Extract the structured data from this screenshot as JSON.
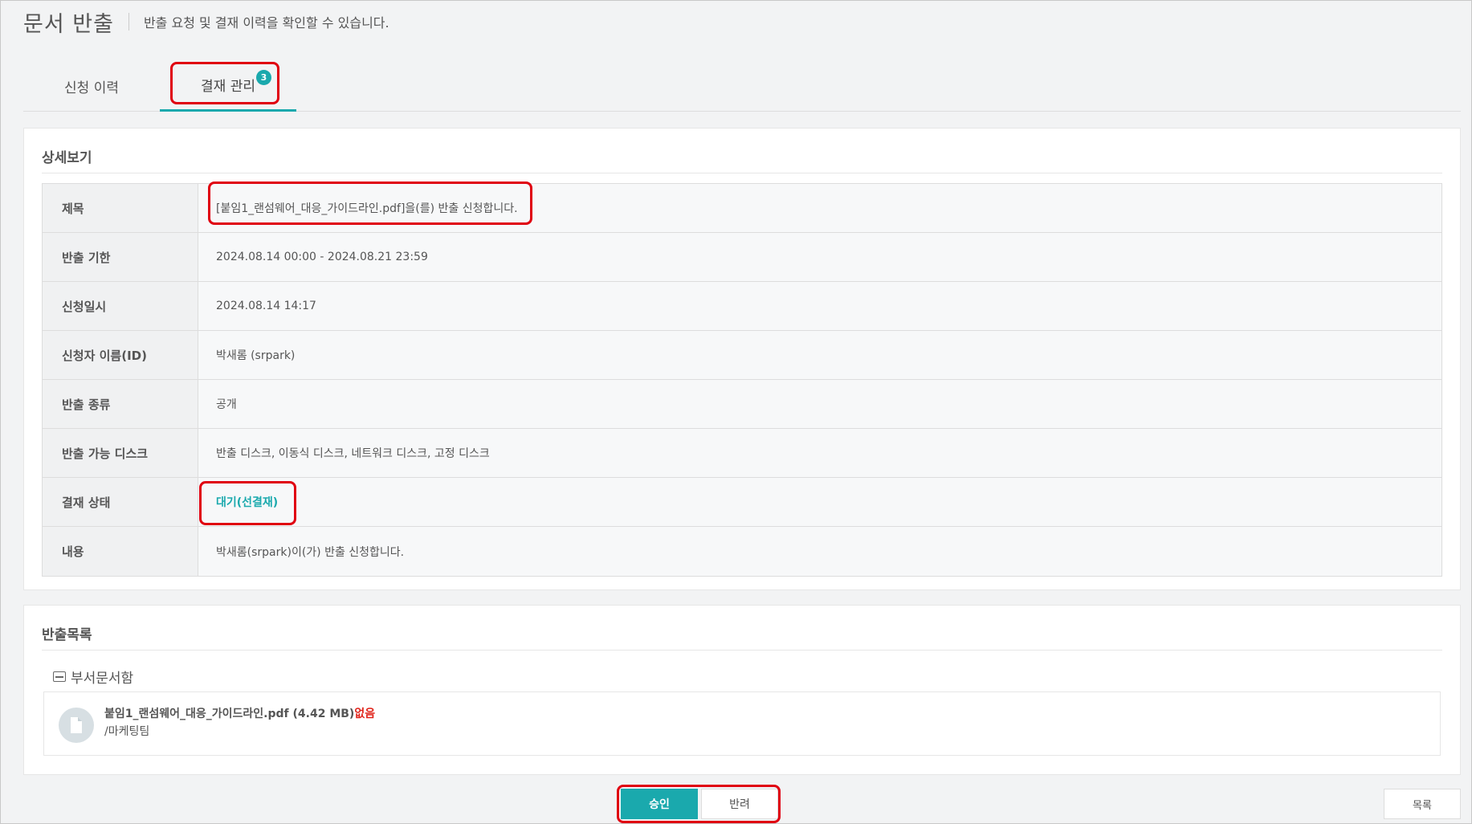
{
  "header": {
    "title": "문서 반출",
    "subtitle": "반출 요청 및 결재 이력을 확인할 수 있습니다."
  },
  "tabs": [
    {
      "label": "신청 이력",
      "active": false
    },
    {
      "label": "결재 관리",
      "active": true,
      "badge": "3"
    }
  ],
  "detail": {
    "section_title": "상세보기",
    "rows": [
      {
        "label": "제목",
        "value": "[붙임1_랜섬웨어_대응_가이드라인.pdf]을(를) 반출 신청합니다."
      },
      {
        "label": "반출 기한",
        "value": "2024.08.14 00:00 - 2024.08.21 23:59"
      },
      {
        "label": "신청일시",
        "value": "2024.08.14 14:17"
      },
      {
        "label": "신청자 이름(ID)",
        "value": "박새롬 (srpark)"
      },
      {
        "label": "반출 종류",
        "value": "공개"
      },
      {
        "label": "반출 가능 디스크",
        "value": "반출 디스크, 이동식 디스크, 네트워크 디스크, 고정 디스크"
      },
      {
        "label": "결재 상태",
        "value": "대기(선결재)"
      },
      {
        "label": "내용",
        "value": "박새롬(srpark)이(가) 반출 신청합니다."
      }
    ]
  },
  "export_list": {
    "section_title": "반출목록",
    "folder_name": "부서문서함",
    "files": [
      {
        "name": "붙임1_랜섬웨어_대응_가이드라인.pdf (4.42 MB)",
        "status": "없음",
        "path": "/마케팅팀"
      }
    ]
  },
  "buttons": {
    "approve": "승인",
    "reject": "반려",
    "list": "목록"
  },
  "colors": {
    "accent": "#1aa9ad",
    "highlight": "#e00010",
    "missing": "#e0241b"
  }
}
